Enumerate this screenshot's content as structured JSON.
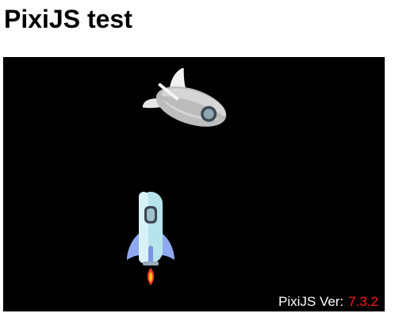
{
  "page": {
    "title": "PixiJS test"
  },
  "stage": {
    "background_color": "#000000",
    "sprites": [
      {
        "name": "ufo-ship",
        "icon": "ufo-ship-icon"
      },
      {
        "name": "rocket-ship",
        "icon": "rocket-ship-icon"
      }
    ],
    "version_label": "PixiJS Ver:",
    "version_value": "7.3.2",
    "version_value_color": "#ff1a1a"
  }
}
